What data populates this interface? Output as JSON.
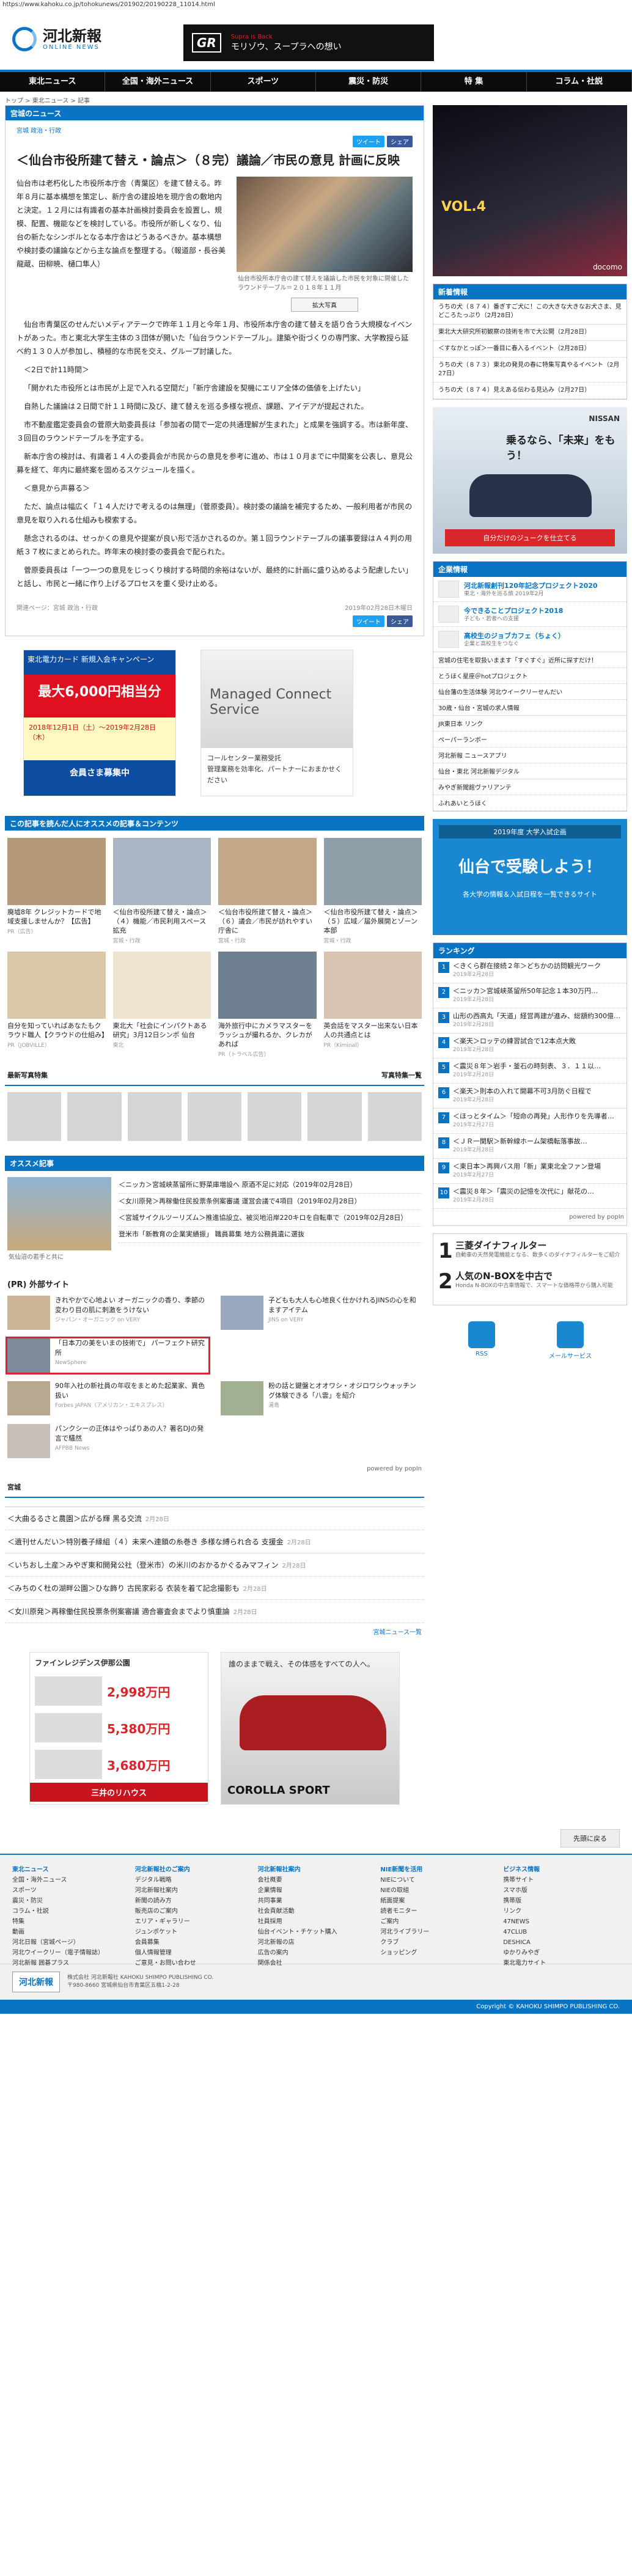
{
  "url": "https://www.kahoku.co.jp/tohokunews/201902/20190228_11014.html",
  "logo": {
    "name": "河北新報",
    "sub": "ONLINE NEWS"
  },
  "top_ad": {
    "brand": "GR",
    "title": "Supra is Back",
    "msg": "モリゾウ、スープラへの想い"
  },
  "nav": [
    "東北ニュース",
    "全国・海外ニュース",
    "スポーツ",
    "震災・防災",
    "特 集",
    "コラム・社説"
  ],
  "breadcrumb": "トップ > 東北ニュース > 記事",
  "article": {
    "section": "宮城のニュース",
    "tags": "宮城 政治・行政",
    "share": {
      "tweet": "ツイート",
      "fb": "シェア"
    },
    "title": "＜仙台市役所建て替え・論点＞（８完）議論／市民の意見 計画に反映",
    "lead": "仙台市は老朽化した市役所本庁舎（青葉区）を建て替える。昨年８月に基本構想を策定し、新庁舎の建設地を現庁舎の敷地内と決定。１２月には有識者の基本計画検討委員会を設置し、規模、配置、機能などを検討している。市役所が新しくなり、仙台の新たなシンボルとなる本庁舎はどうあるべきか。基本構想や検討委の議論などから主な論点を整理する。（報道部・長谷美龍蔵、田柳暁、樋口隼人）",
    "photo_caption": "仙台市役所本庁舎の建て替えを議論した市民を対象に開催したラウンドテーブル＝２０１８年１１月",
    "zoom": "拡大写真",
    "paragraphs": [
      "仙台市青葉区のせんだいメディアテークで昨年１１月と今年１月、市役所本庁舎の建て替えを語り合う大規模なイベントがあった。市と東北大学生主体の３団体が開いた「仙台ラウンドテーブル」。建築や街づくりの専門家、大学教授ら延べ約１３０人が参加し、積極的な市民を交え、グループ討議した。",
      "＜2日で計11時間＞",
      "「開かれた市役所とは市民が上足で入れる空間だ」「新庁舎建設を契機にエリア全体の価値を上げたい」",
      "自熱した議論は２日間で計１１時間に及び、建て替えを巡る多様な視点、課題、アイデアが提起された。",
      "市不動産鑑定委員会の菅原大助委員長は「参加者の間で一定の共通理解が生まれた」と成果を強調する。市は新年度、３回目のラウンドテーブルを予定する。",
      "新本庁舎の検討は、有識者１４人の委員会が市民からの意見を参考に進め、市は１０月までに中間案を公表し、意見公募を経て、年内に最終案を固めるスケジュールを描く。",
      "＜意見から声募る＞",
      "ただ、論点は幅広く「１４人だけで考えるのは無理」（菅原委員）。検討委の議論を補完するため、一般利用者が市民の意見を取り入れる仕組みも模索する。",
      "懸念されるのは、せっかくの意見や提案が良い形で活かされるのか。第１回ラウンドテーブルの議事要録はＡ４判の用紙３７枚にまとめられた。昨年末の検討委の委員会で配られた。",
      "菅原委員長は「一つ一つの意見をじっくり検討する時間的余裕はないが、最終的に計画に盛り込めるよう配慮したい」と話し、市民と一緒に作り上げるプロセスを重く受け止める。"
    ],
    "related": "関連ページ：宮城 政治・行政",
    "date": "2019年02月28日木曜日"
  },
  "ad1": {
    "top": "東北電力カード 新規入会キャンペーン",
    "big": "最大6,000円相当分",
    "mid": "2018年12月1日（土）〜2019年2月28日（木）",
    "btn": "会員さま募集中"
  },
  "ad2": {
    "title": "Managed Connect Service",
    "sub": "コールセンター業務受託",
    "desc": "管理業務を効率化、パートナーにおまかせください"
  },
  "reco_head": "この記事を読んだ人にオススメの記事＆コンテンツ",
  "reco": [
    {
      "t": "廃墟8年 クレジットカードで地域支援しませんか？【広告】",
      "s": "PR（広告）"
    },
    {
      "t": "＜仙台市役所建て替え・論点＞（４）機能／市民利用スペース拡充",
      "s": "宮城・行政"
    },
    {
      "t": "＜仙台市役所建て替え・論点＞（６）議会／市民が訪れやすい庁舎に",
      "s": "宮城・行政"
    },
    {
      "t": "＜仙台市役所建て替え・論点＞（５）広域／届外展開とゾーン本部",
      "s": "宮城・行政"
    },
    {
      "t": "自分を知っていればあなたもクラウド職人【クラウドの仕組み】",
      "s": "PR（JOBVILLE）"
    },
    {
      "t": "東北大「社会にインパクトある研究」3月12日シンポ 仙台",
      "s": "東北"
    },
    {
      "t": "海外旅行中にカメラマスターをラッシュが撮れるか、クレカがあれば",
      "s": "PR（トラベル広告）"
    },
    {
      "t": "英会話をマスター出来ない日本人の共通点とは",
      "s": "PR（Kiminal）"
    }
  ],
  "latest_head": "最新写真特集",
  "latest_more": "写真特集一覧",
  "os_head": "オススメ記事",
  "os_caption": "気仙沼の若手と共に",
  "os_list": [
    "＜ニッカ＞宮城峡蒸留所に野菜庫増設へ 原酒不足に対応（2019年02月28日）",
    "＜女川原発＞再稼働住民投票条例案審議 運営会議で4項目（2019年02月28日）",
    "＜宮城サイクルツーリズム＞推進協設立、被災地沿岸220キロを自転車で（2019年02月28日）",
    "登米市「新教育の企業実績振」 職員募集 地方公務員遺に選抜"
  ],
  "pr_head": "(PR) 外部サイト",
  "pr": [
    {
      "t": "きれやかで心地よい オーガニックの香り、季節の変わり目の肌に刺激をうけない",
      "s": "ジャパン・オーガニック on VERY"
    },
    {
      "t": "子どもも大人も心地良く仕かけれるJINSの心を和ますアイテム",
      "s": "JINS on VERY"
    },
    {
      "t": "「日本刀の美をいまの技術で」 パーフェクト研究所",
      "s": "NewSphere"
    },
    {
      "t": "",
      "s": ""
    },
    {
      "t": "90年入社の新社員の年収をまとめた起業家、異色扱い",
      "s": "Forbes JAPAN（アメリカン・エキスプレス）"
    },
    {
      "t": "粉の話と鍵盤とオオワシ・オジロワシウォッチング体験できる「八雲」を紹介",
      "s": "湯島"
    },
    {
      "t": "パンクシーの正体はやっぱりあの人？著名DJの発言で騒然",
      "s": "AFPBB News"
    },
    {
      "t": "",
      "s": ""
    }
  ],
  "powered": "powered by popIn",
  "region_head": "宮城",
  "region": [
    {
      "t": "＜大曲るるさと農園＞広がる輝 黒る交流",
      "d": "2月28日"
    },
    {
      "t": "＜遺刊せんだい＞特別養子縁組（４）未来へ連鎖の糸巻き 多様な縛られ合る 支援金",
      "d": "2月28日"
    },
    {
      "t": "＜いちおし土産＞みやぎ東和開発公社（登米市）の米川のおかるかぐるみマフィン",
      "d": "2月28日"
    },
    {
      "t": "＜みちのく杜の湖畔公園＞ひな飾り 古民家彩る 衣装を着て記念撮影も",
      "d": "2月28日"
    },
    {
      "t": "＜女川原発＞再稼働住民投票条例案審議 適合審査会までより慎重論",
      "d": "2月28日"
    }
  ],
  "region_more": "宮城ニュース一覧",
  "bad1": {
    "h": "ファインレジデンス伊那公園",
    "p1": "2,998万円",
    "p2": "5,380万円",
    "p3": "3,680万円",
    "brand": "三井のリハウス"
  },
  "bad2": {
    "tx": "誰のままで戦え、その体感をすべての人へ。",
    "tt": "COROLLA SPORT"
  },
  "pagetop": "先頭に戻る",
  "footer": [
    {
      "h": "東北ニュース",
      "items": [
        "全国・海外ニュース",
        "スポーツ",
        "震災・防災",
        "コラム・社説",
        "特集",
        "動画",
        "河北日報（宮城ページ）",
        "河北ウイークリー（電子情報誌）",
        "河北新報 囲碁プラス"
      ]
    },
    {
      "h": "河北新報社のご案内",
      "items": [
        "デジタル戦略",
        "河北新報社案内",
        "新聞の読み方",
        "販売店のご案内",
        "エリア・ギャラリー",
        "ジュンポケット",
        "会員募集",
        "個人情報管理",
        "ご意見・お問い合わせ"
      ]
    },
    {
      "h": "河北新報社案内",
      "items": [
        "会社概要",
        "企業情報",
        "共同事業",
        "社会貢献活動",
        "社員採用",
        "仙台イベント・チケット購入",
        "河北新報の店",
        "広告の案内",
        "関係会社"
      ]
    },
    {
      "h": "NIE新聞を活用",
      "items": [
        "NIEについて",
        "NIEの取組",
        "紙面提案",
        "読者モニター",
        "ご案内",
        "河北ライブラリー",
        "クラブ",
        "ショッピング"
      ]
    },
    {
      "h": "ビジネス情報",
      "items": [
        "携帯サイト",
        "スマホ版",
        "携帯版",
        "リンク",
        "47NEWS",
        "47CLUB",
        "DESHICA",
        "ゆかりみやぎ",
        "東北電力サイト"
      ]
    }
  ],
  "fbrand": {
    "name": "河北新報",
    "addr": "株式会社 河北新報社 KAHOKU SHIMPO PUBLISHING CO.",
    "sub": "〒980-8660 宮城県仙台市青葉区五橋1-2-28"
  },
  "copyright": "Copyright © KAHOKU SHIMPO PUBLISHING CO.",
  "side": {
    "top_ad": {
      "v": "VOL.4",
      "d": "docomo"
    },
    "news_head": "新着情報",
    "news": [
      "うちの犬（８７４）番ぎすご犬に！この大きな大きなお犬さま、見どころたっぷり（2月28日）",
      "東北大大研究所初観察の技術を市で大公開（2月28日）",
      "＜すなかとっぽ＞一番目に春入るイベント（2月28日）",
      "うちの犬（８７３）東北の発見の春に特集写真やるイベント（2月27日）",
      "うちの犬（８７４）見えある伝わる見込み（2月27日）"
    ],
    "nissan": {
      "tt": "乗るなら、「未来」をもう！",
      "lg": "NISSAN",
      "btn": "自分だけのジュークを仕立てる"
    },
    "corp_head": "企業情報",
    "corp": [
      {
        "t": "河北新報創刊120年記念プロジェクト2020",
        "d": "東北・海外を巡る旅 2019年2月"
      },
      {
        "t": "今できることプロジェクト2018",
        "d": "子ども・若者への支援"
      },
      {
        "t": "高校生のジョブカフェ（ちょく）",
        "d": "企業と高校生をつなぐ"
      }
    ],
    "links": [
      "宮城の住宅を取扱いまます「すぐすぐ」近所に探すだけ！",
      "とうほく星座＠hotプロジェクト",
      "仙台藩の生活体験 河北ウイークリーせんだい",
      "30歳・仙台・宮城の求人情報",
      "JR東日本 リンク",
      "ペーパーランボー",
      "河北新報 ニュースアプリ",
      "仙台・東北 河北新報デジタル",
      "みやぎ新聞館ヴァリアンテ",
      "ふれあいとうほく"
    ],
    "exam": {
      "y": "2019年度 大学入試企画",
      "t": "仙台で受験しよう！",
      "s": "各大学の情報＆入試日程を一覧できるサイト"
    },
    "rank_head": "ランキング",
    "rank": [
      {
        "t": "＜きくら群在接続２年＞どちかの訪問観光ワーク",
        "d": "2019年2月28日"
      },
      {
        "t": "＜ニッカ＞宮城峡蒸留所50年記念１本30万円…",
        "d": "2019年2月28日"
      },
      {
        "t": "山形の西高丸「天道」経営再建が進み、総額約300億…",
        "d": "2019年2月28日"
      },
      {
        "t": "＜楽天＞ロッテの練習試合で12本点大敗",
        "d": "2019年2月28日"
      },
      {
        "t": "＜震災８年＞岩手・釜石の時刻表、３．１１以…",
        "d": "2019年2月28日"
      },
      {
        "t": "＜楽天＞則本の入れて開幕不可3月防ぐ日程で",
        "d": "2019年2月28日"
      },
      {
        "t": "＜ほっとタイム＞「短命の再発」人形作りを先導者…",
        "d": "2019年2月27日"
      },
      {
        "t": "＜ＪＲ一関駅＞新幹線ホーム架橋転落事故…",
        "d": "2019年2月28日"
      },
      {
        "t": "＜東日本＞再興バス用「新」業東北全ファン登場",
        "d": "2019年2月27日"
      },
      {
        "t": "＜震災８年＞「震災の記憶を次代に」献花の…",
        "d": "2019年2月28日"
      }
    ],
    "powered": "powered by popIn",
    "filt": [
      {
        "n": "1",
        "t": "三菱ダイナフィルター",
        "s": "自動車の天然発電機能となる、数多くのダイナフィルターをご紹介"
      },
      {
        "n": "2",
        "t": "人気のN-BOXを中古で",
        "s": "Honda N-BOXの中古車情報で、スマートな価格帯から購入可能"
      }
    ],
    "icons": [
      "RSS",
      "メールサービス"
    ]
  }
}
